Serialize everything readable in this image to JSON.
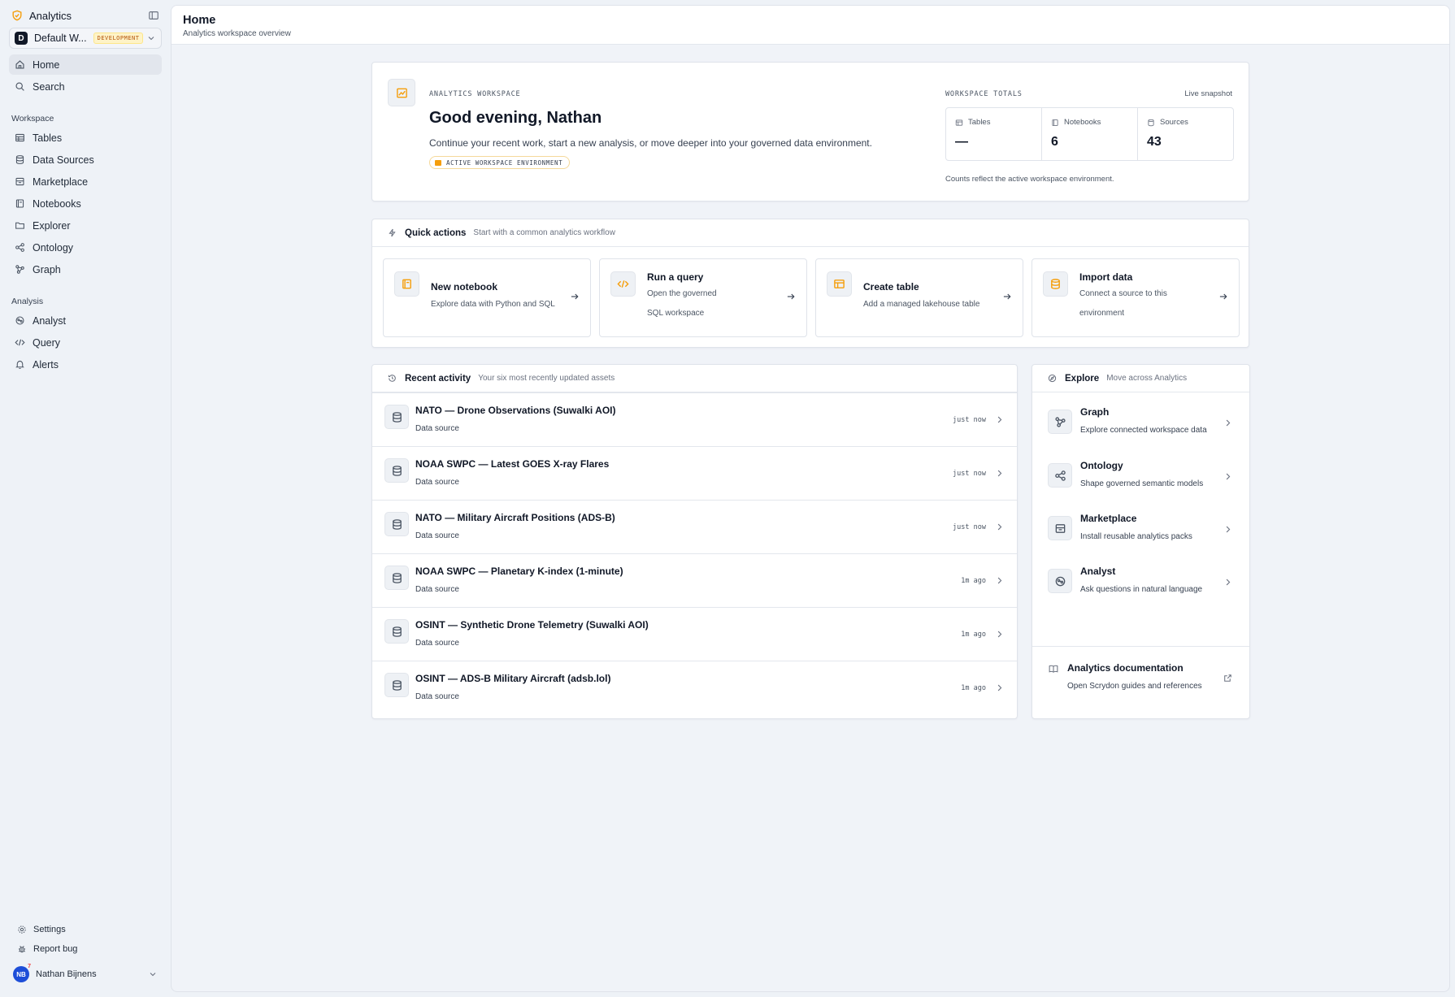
{
  "sidebar": {
    "brand": "Analytics",
    "workspace": {
      "initial": "D",
      "name": "Default W...",
      "env_badge": "DEVELOPMENT"
    },
    "primary": [
      {
        "label": "Home",
        "icon": "home-icon"
      },
      {
        "label": "Search",
        "icon": "search-icon"
      }
    ],
    "workspace_section": "Workspace",
    "workspace_items": [
      {
        "label": "Tables",
        "icon": "table-icon"
      },
      {
        "label": "Data Sources",
        "icon": "database-icon"
      },
      {
        "label": "Marketplace",
        "icon": "store-icon"
      },
      {
        "label": "Notebooks",
        "icon": "notebook-icon"
      },
      {
        "label": "Explorer",
        "icon": "folder-icon"
      },
      {
        "label": "Ontology",
        "icon": "share-nodes-icon"
      },
      {
        "label": "Graph",
        "icon": "graph-icon"
      }
    ],
    "analysis_section": "Analysis",
    "analysis_items": [
      {
        "label": "Analyst",
        "icon": "brain-icon"
      },
      {
        "label": "Query",
        "icon": "code-icon"
      },
      {
        "label": "Alerts",
        "icon": "bell-icon"
      }
    ],
    "bottom": [
      {
        "label": "Settings",
        "icon": "gear-icon"
      },
      {
        "label": "Report bug",
        "icon": "bug-icon"
      }
    ],
    "user": {
      "initials": "NB",
      "badge": "7",
      "name": "Nathan Bijnens"
    }
  },
  "header": {
    "title": "Home",
    "subtitle": "Analytics workspace overview"
  },
  "hero": {
    "eyebrow": "ANALYTICS WORKSPACE",
    "greeting": "Good evening, Nathan",
    "description": "Continue your recent work, start a new analysis, or move deeper into your governed data environment.",
    "env_tag": "ACTIVE WORKSPACE ENVIRONMENT",
    "totals_label": "WORKSPACE TOTALS",
    "snapshot": "Live snapshot",
    "stats": [
      {
        "label": "Tables",
        "value": "—"
      },
      {
        "label": "Notebooks",
        "value": "6"
      },
      {
        "label": "Sources",
        "value": "43"
      }
    ],
    "note": "Counts reflect the active workspace environment."
  },
  "quick_actions": {
    "title": "Quick actions",
    "subtitle": "Start with a common analytics workflow",
    "items": [
      {
        "title": "New notebook",
        "desc": "Explore data with Python and SQL"
      },
      {
        "title": "Run a query",
        "desc": "Open the governed SQL workspace"
      },
      {
        "title": "Create table",
        "desc": "Add a managed lakehouse table"
      },
      {
        "title": "Import data",
        "desc": "Connect a source to this environment"
      }
    ]
  },
  "recent": {
    "title": "Recent activity",
    "subtitle": "Your six most recently updated assets",
    "items": [
      {
        "title": "NATO — Drone Observations (Suwalki AOI)",
        "kind": "Data source",
        "time": "just now"
      },
      {
        "title": "NOAA SWPC — Latest GOES X-ray Flares",
        "kind": "Data source",
        "time": "just now"
      },
      {
        "title": "NATO — Military Aircraft Positions (ADS-B)",
        "kind": "Data source",
        "time": "just now"
      },
      {
        "title": "NOAA SWPC — Planetary K-index (1-minute)",
        "kind": "Data source",
        "time": "1m ago"
      },
      {
        "title": "OSINT — Synthetic Drone Telemetry (Suwalki AOI)",
        "kind": "Data source",
        "time": "1m ago"
      },
      {
        "title": "OSINT — ADS-B Military Aircraft (adsb.lol)",
        "kind": "Data source",
        "time": "1m ago"
      }
    ]
  },
  "explore": {
    "title": "Explore",
    "subtitle": "Move across Analytics",
    "items": [
      {
        "title": "Graph",
        "desc": "Explore connected workspace data"
      },
      {
        "title": "Ontology",
        "desc": "Shape governed semantic models"
      },
      {
        "title": "Marketplace",
        "desc": "Install reusable analytics packs"
      },
      {
        "title": "Analyst",
        "desc": "Ask questions in natural language"
      }
    ],
    "docs": {
      "title": "Analytics documentation",
      "desc": "Open Scrydon guides and references"
    }
  }
}
